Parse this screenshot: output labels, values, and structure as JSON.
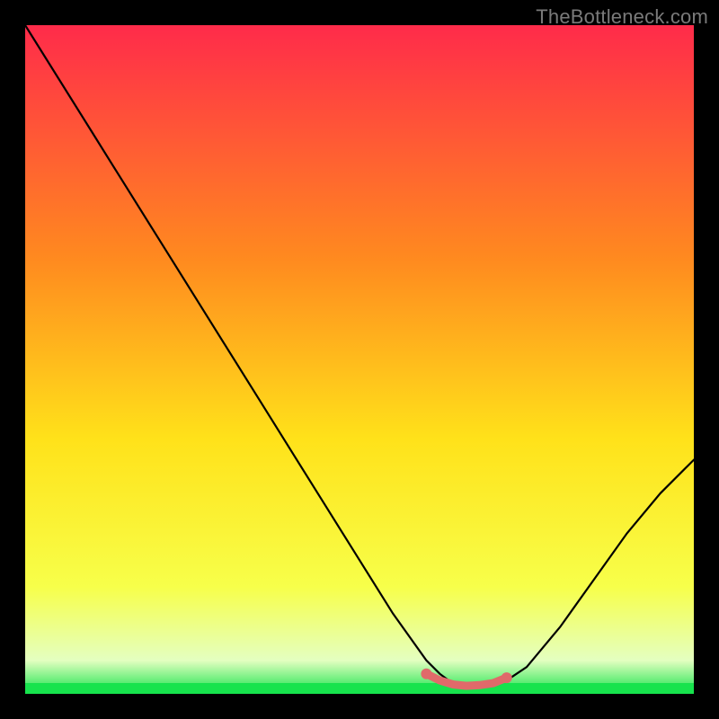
{
  "watermark": "TheBottleneck.com",
  "colors": {
    "background": "#000000",
    "gradient_top": "#ff2b4a",
    "gradient_mid1": "#ff8a1f",
    "gradient_mid2": "#ffe21a",
    "gradient_mid3": "#f7ff4a",
    "gradient_bottom_fade": "#e4ffc0",
    "green_band": "#17e34d",
    "curve_stroke": "#000000",
    "marker_stroke": "#e06a6a",
    "marker_fill": "#e06a6a"
  },
  "chart_data": {
    "type": "line",
    "title": "",
    "xlabel": "",
    "ylabel": "",
    "xlim": [
      0,
      100
    ],
    "ylim": [
      0,
      100
    ],
    "grid": false,
    "legend": false,
    "series": [
      {
        "name": "bottleneck-curve",
        "x": [
          0,
          5,
          10,
          15,
          20,
          25,
          30,
          35,
          40,
          45,
          50,
          55,
          60,
          62,
          64,
          66,
          68,
          70,
          72,
          75,
          80,
          85,
          90,
          95,
          100
        ],
        "y": [
          100,
          92,
          84,
          76,
          68,
          60,
          52,
          44,
          36,
          28,
          20,
          12,
          5,
          3,
          1.5,
          1,
          1,
          1.2,
          2,
          4,
          10,
          17,
          24,
          30,
          35
        ]
      }
    ],
    "highlight_segment": {
      "name": "optimal-range",
      "x": [
        60,
        62,
        64,
        66,
        68,
        70,
        72
      ],
      "y": [
        3,
        2,
        1.4,
        1.2,
        1.3,
        1.6,
        2.4
      ]
    },
    "highlight_endpoints": {
      "start": {
        "x": 60,
        "y": 3
      },
      "end": {
        "x": 72,
        "y": 2.4
      }
    }
  }
}
